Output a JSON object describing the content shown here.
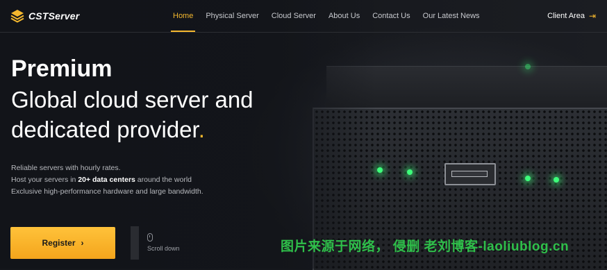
{
  "brand": {
    "name": "CSTServer",
    "logo_icon": "stacked-layers-logo-icon",
    "accent": "#f5b82e"
  },
  "nav": {
    "items": [
      {
        "label": "Home",
        "active": true
      },
      {
        "label": "Physical Server",
        "active": false
      },
      {
        "label": "Cloud Server",
        "active": false
      },
      {
        "label": "About Us",
        "active": false
      },
      {
        "label": "Contact Us",
        "active": false
      },
      {
        "label": "Our Latest News",
        "active": false
      }
    ],
    "client_area": "Client Area",
    "client_icon": "sign-in-arrow-icon"
  },
  "hero": {
    "title_bold": "Premium",
    "title_line1": "Global cloud server and",
    "title_line2": "dedicated provider",
    "title_dot": ".",
    "desc_line1": "Reliable servers with hourly rates.",
    "desc_line2_pre": "Host your servers in ",
    "desc_line2_bold": "20+ data centers",
    "desc_line2_post": " around the world",
    "desc_line3": "Exclusive high-performance hardware and large bandwidth.",
    "register_label": "Register",
    "scroll_label": "Scroll down"
  },
  "watermark": "图片来源于网络， 侵删 老刘博客-laoliublog.cn"
}
